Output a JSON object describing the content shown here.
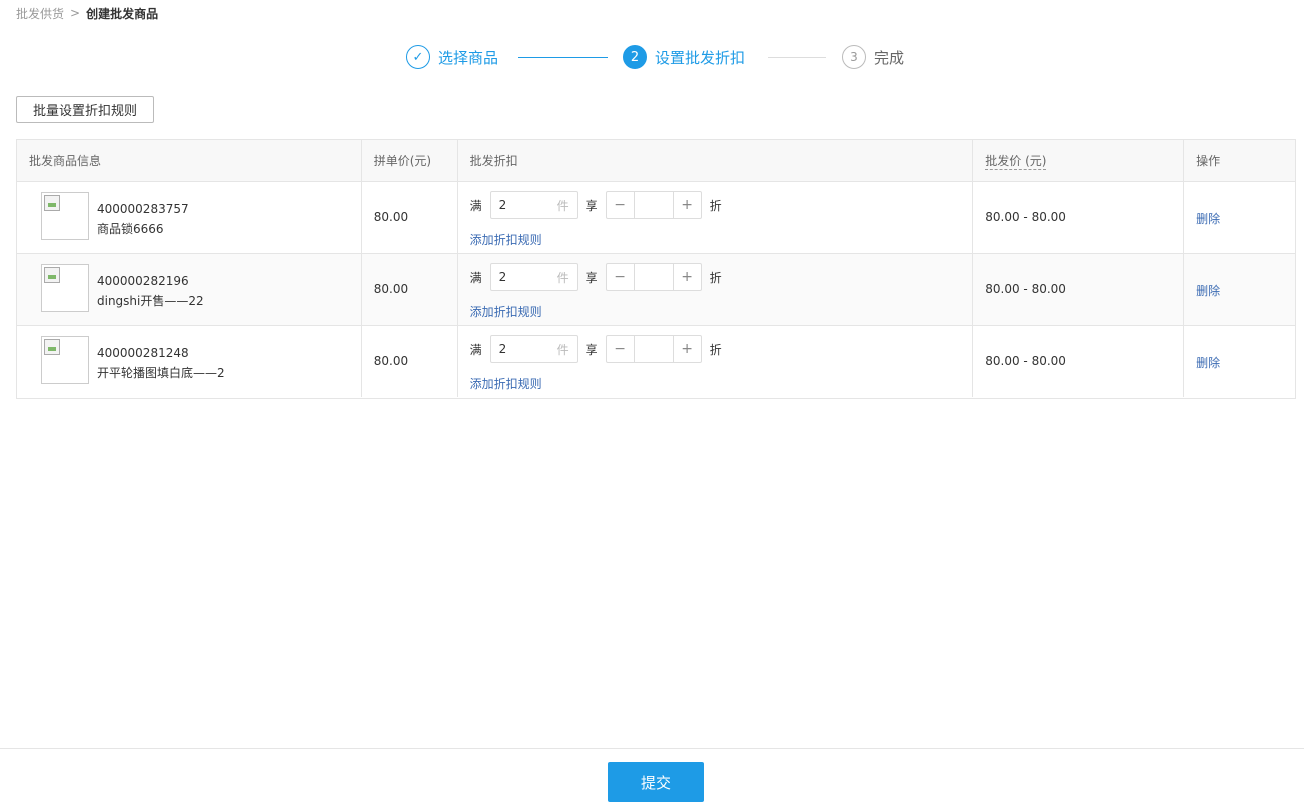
{
  "breadcrumb": {
    "parent": "批发供货",
    "separator": ">",
    "current": "创建批发商品"
  },
  "steps": [
    {
      "index": "✓",
      "label": "选择商品",
      "state": "done"
    },
    {
      "index": "2",
      "label": "设置批发折扣",
      "state": "active"
    },
    {
      "index": "3",
      "label": "完成",
      "state": "todo"
    }
  ],
  "batch_button": "批量设置折扣规则",
  "table": {
    "headers": {
      "info": "批发商品信息",
      "price": "拼单价(元)",
      "discount": "批发折扣",
      "wholesale": "批发价 (元)",
      "op": "操作"
    },
    "rows": [
      {
        "id": "400000283757",
        "name": "商品锁6666",
        "price": "80.00",
        "rule": {
          "man": "满",
          "qty": "2",
          "unit": "件",
          "xiang": "享",
          "minus": "−",
          "plus": "+",
          "zhe": "折"
        },
        "add_rule": "添加折扣规则",
        "wholesale": "80.00 - 80.00",
        "op": "删除"
      },
      {
        "id": "400000282196",
        "name": "dingshi开售——22",
        "price": "80.00",
        "rule": {
          "man": "满",
          "qty": "2",
          "unit": "件",
          "xiang": "享",
          "minus": "−",
          "plus": "+",
          "zhe": "折"
        },
        "add_rule": "添加折扣规则",
        "wholesale": "80.00 - 80.00",
        "op": "删除"
      },
      {
        "id": "400000281248",
        "name": "开平轮播图填白底——2",
        "price": "80.00",
        "rule": {
          "man": "满",
          "qty": "2",
          "unit": "件",
          "xiang": "享",
          "minus": "−",
          "plus": "+",
          "zhe": "折"
        },
        "add_rule": "添加折扣规则",
        "wholesale": "80.00 - 80.00",
        "op": "删除"
      }
    ]
  },
  "submit_button": "提交",
  "colors": {
    "primary": "#1e9be6",
    "link": "#3b6bb3",
    "border": "#e5e5e5"
  },
  "icons": {
    "chevron": "chevron-right-icon",
    "check": "check-icon",
    "image": "broken-image-icon"
  }
}
